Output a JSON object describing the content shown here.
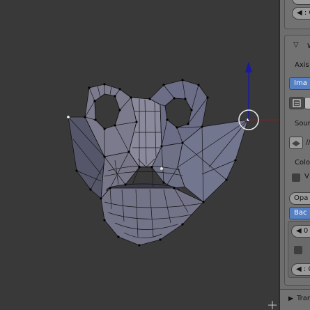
{
  "viewport": {
    "manipulator_icon": "rotate-manipulator-icon",
    "grab_axis_color": "#1a1aa0",
    "x_axis_color": "#a01818",
    "mesh_color": "#6a6a80"
  },
  "panel": {
    "top_field_text": "◀ : C",
    "section_title": "W",
    "axis_label": "Axis:",
    "image_button": "Ima",
    "source_label": "Sourc",
    "path_text": "//",
    "color_label": "Color",
    "v_checkbox": "V",
    "opacity_button": "Opa",
    "background_button": "Bac",
    "num_field": "◀ 0",
    "checkbox_empty": "",
    "bottom_field": "◀ : C",
    "transform_label": "Trar"
  }
}
